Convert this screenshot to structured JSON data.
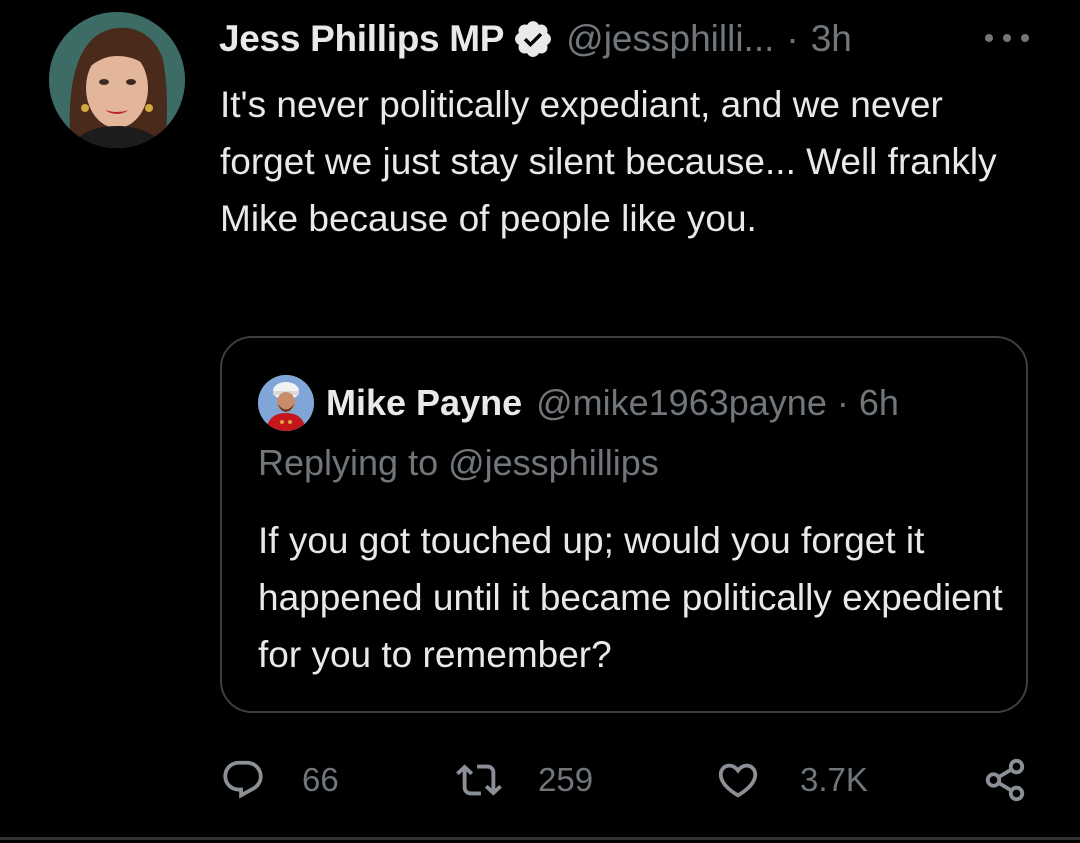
{
  "tweet": {
    "author": {
      "display_name": "Jess Phillips MP",
      "handle": "@jessphilli...",
      "verified": true,
      "avatar_icon": "avatar-photo"
    },
    "separator": "·",
    "time": "3h",
    "more_icon": "more-horizontal-icon",
    "text": "It's never politically expediant, and we never forget we just stay silent because... Well frankly Mike because of people like you."
  },
  "quoted_tweet": {
    "author": {
      "display_name": "Mike Payne",
      "handle": "@mike1963payne",
      "avatar_icon": "avatar-photo"
    },
    "separator": "·",
    "time": "6h",
    "replying_to": "Replying to @jessphillips",
    "text": "If you got touched up; would you forget it happened until it became politically expedient for you to remember?"
  },
  "actions": {
    "reply": {
      "icon": "reply-icon",
      "count": "66"
    },
    "retweet": {
      "icon": "retweet-icon",
      "count": "259"
    },
    "like": {
      "icon": "heart-icon",
      "count": "3.7K"
    },
    "share": {
      "icon": "share-icon"
    }
  },
  "colors": {
    "background": "#000000",
    "primary_text": "#e7e9ea",
    "secondary_text": "#71767b",
    "border": "#3a3f44",
    "verified_badge": "#e7e9ea"
  }
}
